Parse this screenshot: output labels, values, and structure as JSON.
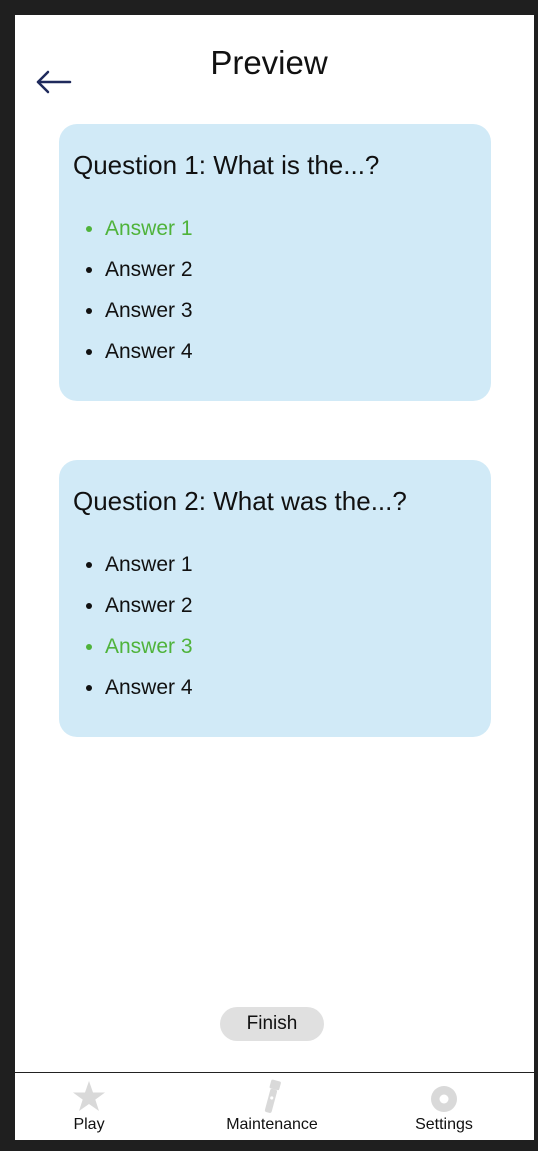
{
  "header": {
    "title": "Preview",
    "back_icon": "arrow-left-icon"
  },
  "questions": [
    {
      "text": "Question 1: What is the...?",
      "answers": [
        {
          "label": "Answer 1",
          "correct": true
        },
        {
          "label": "Answer 2",
          "correct": false
        },
        {
          "label": "Answer 3",
          "correct": false
        },
        {
          "label": "Answer 4",
          "correct": false
        }
      ]
    },
    {
      "text": "Question 2: What was the...?",
      "answers": [
        {
          "label": "Answer 1",
          "correct": false
        },
        {
          "label": "Answer 2",
          "correct": false
        },
        {
          "label": "Answer 3",
          "correct": true
        },
        {
          "label": "Answer 4",
          "correct": false
        }
      ]
    }
  ],
  "finish_label": "Finish",
  "navbar": {
    "items": [
      {
        "label": "Play",
        "icon": "star-icon"
      },
      {
        "label": "Maintenance",
        "icon": "flashlight-icon"
      },
      {
        "label": "Settings",
        "icon": "gear-icon"
      }
    ]
  },
  "colors": {
    "card_background": "#d1eaf7",
    "correct_answer": "#4fb33b",
    "nav_icon": "#d9d9d9",
    "finish_button": "#e0e0e0",
    "back_arrow": "#1f2a5c"
  }
}
